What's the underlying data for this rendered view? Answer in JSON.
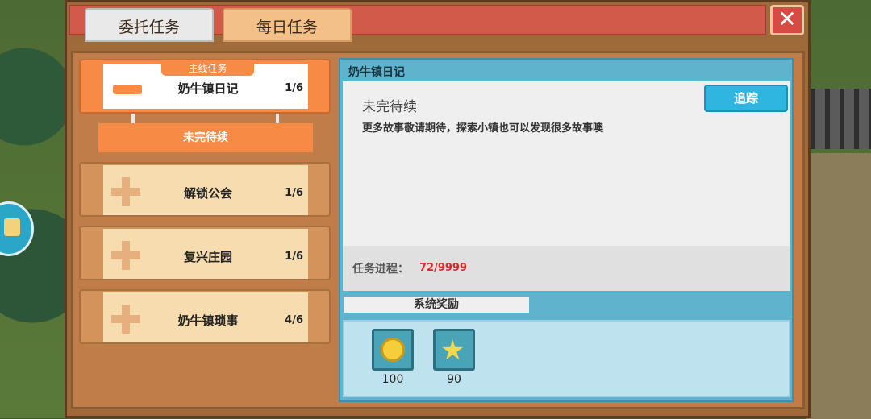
{
  "tabs": [
    {
      "label": "委托任务",
      "active": true
    },
    {
      "label": "每日任务",
      "active": false
    }
  ],
  "close_label": "✕",
  "quest_list": {
    "ribbon_label": "主线任务",
    "items": [
      {
        "name": "奶牛镇日记",
        "count": "1/6",
        "expanded": true
      },
      {
        "name": "解锁公会",
        "count": "1/6"
      },
      {
        "name": "复兴庄园",
        "count": "1/6"
      },
      {
        "name": "奶牛镇琐事",
        "count": "4/6"
      }
    ],
    "sub_item": "未完待续"
  },
  "detail": {
    "title": "奶牛镇日记",
    "heading": "未完待续",
    "description": "更多故事敬请期待，探索小镇也可以发现很多故事噢",
    "track_button": "追踪",
    "progress_label": "任务进程：",
    "progress_value": "72/9999"
  },
  "rewards": {
    "tab_label": "系统奖励",
    "items": [
      {
        "icon": "coin-icon",
        "value": "100"
      },
      {
        "icon": "star-icon",
        "value": "90"
      }
    ]
  },
  "colors": {
    "accent_orange": "#f78a45",
    "panel_blue": "#5fb3cc",
    "progress_red": "#e0282a",
    "button_blue": "#2fb6e0"
  }
}
